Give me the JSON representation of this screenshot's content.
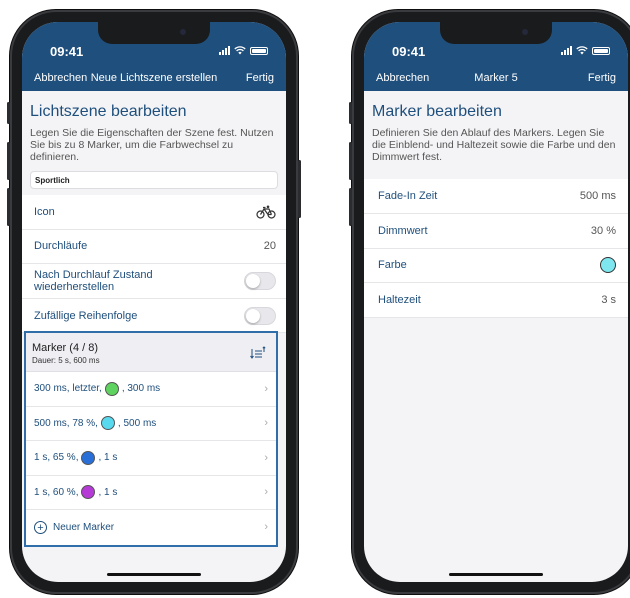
{
  "left": {
    "status": {
      "time": "09:41"
    },
    "nav": {
      "left": "Abbrechen",
      "title": "Neue Lichtszene erstellen",
      "right": "Fertig"
    },
    "title": "Lichtszene bearbeiten",
    "description": "Legen Sie die Eigenschaften der Szene fest. Nutzen Sie bis zu 8 Marker, um die Farbwechsel zu definieren.",
    "name_value": "Sportlich",
    "rows": {
      "icon": {
        "label": "Icon",
        "icon": "bicycle-icon"
      },
      "durchlaeufe": {
        "label": "Durchläufe",
        "value": "20"
      },
      "restore": {
        "label": "Nach Durchlauf Zustand wiederherstellen"
      },
      "random": {
        "label": "Zufällige Reihenfolge"
      }
    },
    "marker_section": {
      "title": "Marker (4 / 8)",
      "duration": "Dauer: 5 s, 600 ms",
      "items": [
        {
          "pre": "300 ms, letzter,",
          "post": ", 300 ms",
          "color": "#5fd35f"
        },
        {
          "pre": "500 ms, 78 %,",
          "post": ", 500 ms",
          "color": "#59d9ee"
        },
        {
          "pre": "1 s, 65 %,",
          "post": ", 1 s",
          "color": "#2a6fd8"
        },
        {
          "pre": "1 s, 60 %,",
          "post": ", 1 s",
          "color": "#b63ad6"
        }
      ],
      "new_marker": "Neuer Marker"
    }
  },
  "right": {
    "status": {
      "time": "09:41"
    },
    "nav": {
      "left": "Abbrechen",
      "title": "Marker 5",
      "right": "Fertig"
    },
    "title": "Marker bearbeiten",
    "description": "Definieren Sie den Ablauf des Markers. Legen Sie die Einblend- und Haltezeit sowie die Farbe und den Dimmwert fest.",
    "rows": {
      "fade": {
        "label": "Fade-In Zeit",
        "value": "500 ms"
      },
      "dimm": {
        "label": "Dimmwert",
        "value": "30 %"
      },
      "farbe": {
        "label": "Farbe",
        "color": "#7ee6ef"
      },
      "halte": {
        "label": "Haltezeit",
        "value": "3 s"
      }
    }
  },
  "theme": {
    "nav_color": "#1f4f7c",
    "accent": "#2f6ea8"
  }
}
